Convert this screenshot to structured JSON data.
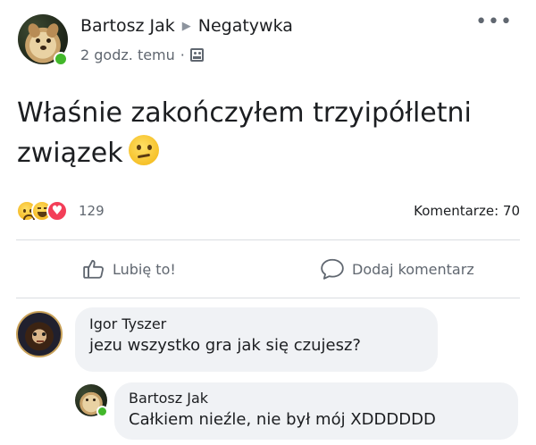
{
  "post": {
    "author": "Bartosz Jak",
    "group": "Negatywka",
    "time": "2 godz. temu",
    "separator": "·",
    "text": "Właśnie zakończyłem trzyipółletni związek",
    "more_icon": "more-horizontal-icon"
  },
  "stats": {
    "reaction_icons": [
      "sad-reaction-icon",
      "haha-reaction-icon",
      "love-reaction-icon"
    ],
    "reaction_count": "129",
    "comments_label": "Komentarze: 70"
  },
  "actions": {
    "like_label": "Lubię to!",
    "comment_label": "Dodaj komentarz"
  },
  "comments": [
    {
      "author": "Igor Tyszer",
      "text": "jezu wszystko gra jak się czujesz?"
    },
    {
      "author": "Bartosz Jak",
      "text": "Całkiem nieźle, nie był mój XDDDDDD"
    }
  ],
  "colors": {
    "online": "#42b72a",
    "love": "#f33e58",
    "bubble": "#f0f2f5",
    "secondary_text": "#606770"
  }
}
